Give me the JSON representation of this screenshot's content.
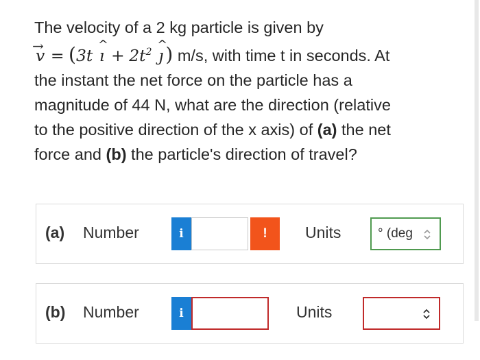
{
  "question": {
    "line1": "The velocity of a 2 kg particle is given by",
    "v_symbol": "v",
    "equals": "=",
    "term1": "3t",
    "i_hat": "ı",
    "plus": "+",
    "term2": "2t",
    "exp": "2",
    "j_hat": "ȷ",
    "line2_tail": "m/s, with time t in seconds. At",
    "line3": "the instant the net force on the particle has a",
    "line4": "magnitude of 44 N, what are the direction (relative",
    "line5_pre": "to the positive direction of the x axis) of ",
    "part_a": "(a)",
    "line5_post": " the net",
    "line6_pre": "force and ",
    "part_b": "(b)",
    "line6_post": " the particle's direction of travel?"
  },
  "answers": [
    {
      "part": "(a)",
      "number_label": "Number",
      "info": "i",
      "warn": "!",
      "units_label": "Units",
      "unit_value": "° (deg",
      "value": ""
    },
    {
      "part": "(b)",
      "number_label": "Number",
      "info": "i",
      "units_label": "Units",
      "unit_value": "",
      "value": ""
    }
  ],
  "colors": {
    "info": "#1a7fd4",
    "warn": "#f2541b",
    "ok": "#4f9a4f",
    "error": "#c02a2a"
  }
}
